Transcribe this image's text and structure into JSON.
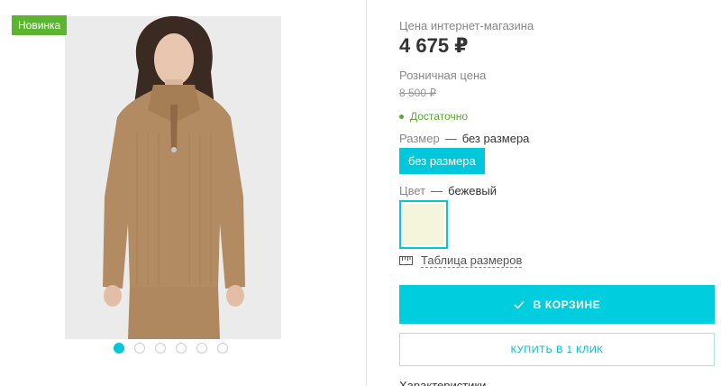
{
  "gallery": {
    "badge": "Новинка",
    "photo_alt": "knitted-sweater-photo",
    "dots_total": 6,
    "dots_active": 0
  },
  "product": {
    "online_price_label": "Цена интернет-магазина",
    "online_price": "4 675 ₽",
    "retail_price_label": "Розничная цена",
    "retail_price": "8 500 ₽",
    "stock_status": "Достаточно",
    "size_label": "Размер",
    "size_value": "без размера",
    "size_option": "без размера",
    "color_label": "Цвет",
    "color_value": "бежевый",
    "color_swatch": "#f5f5dc",
    "size_table": "Таблица размеров",
    "cart_button": "В КОРЗИНЕ",
    "one_click_button": "КУПИТЬ В 1 КЛИК",
    "specs_heading": "Характеристики"
  },
  "colors": {
    "accent": "#00c8dc",
    "badge": "#5cb531",
    "stock": "#5aa832"
  }
}
